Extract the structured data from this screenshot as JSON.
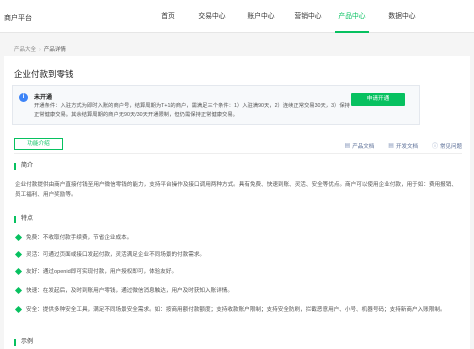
{
  "header": {
    "brand": "商户平台",
    "nav": [
      {
        "label": "首页",
        "active": false
      },
      {
        "label": "交易中心",
        "active": false
      },
      {
        "label": "账户中心",
        "active": false
      },
      {
        "label": "营销中心",
        "active": false
      },
      {
        "label": "产品中心",
        "active": true
      },
      {
        "label": "数据中心",
        "active": false
      }
    ]
  },
  "breadcrumb": {
    "parent": "产品大全",
    "current": "产品详情"
  },
  "page_title": "企业付款到零钱",
  "status": {
    "icon": "info-icon",
    "title": "未开通",
    "description": "开通条件：入驻方式为即时入账的商户号，结算周期为T+1的商户，需满足三个条件：1）入驻满90天，2）连续正常交易30天，3）保持正常健康交易。其余结算周期的商户无90天/30天开通限制，但仍需保持正常健康交易。",
    "apply_label": "申请开通"
  },
  "tabs": {
    "function_intro": "功能介绍"
  },
  "doc_links": {
    "product_doc": "产品文档",
    "dev_doc": "开发文档",
    "faq": "常见问题"
  },
  "intro": {
    "heading": "简介",
    "text": "企业付款提供由商户直接付钱至用户微信零钱的能力，支持平台操作及接口调用两种方式。具有免费、快速到账、灵活、安全等优点。商户可以使用企业付款，用于如：费用报销、员工福利、用户奖励等。"
  },
  "features": {
    "heading": "特点",
    "items": [
      "免费：不收取付款手续费，节省企业成本。",
      "灵活：可通过页面或接口发起付款，灵活满足企业不同场景的付款需求。",
      "友好：通过openid即可实现付款，用户授权即可，体验友好。",
      "快速：在发起后，及时到账用户零钱，通过微信消息触达，用户及时获知入账详情。",
      "安全：提供多种安全工具，满足不同场景安全需求。如：按商用额付款额度；支持收款账户限制；支持安全防刷，拦截恶意用户、小号、机器号码；支持新商户入账限制。"
    ]
  },
  "example": {
    "heading": "示例"
  }
}
